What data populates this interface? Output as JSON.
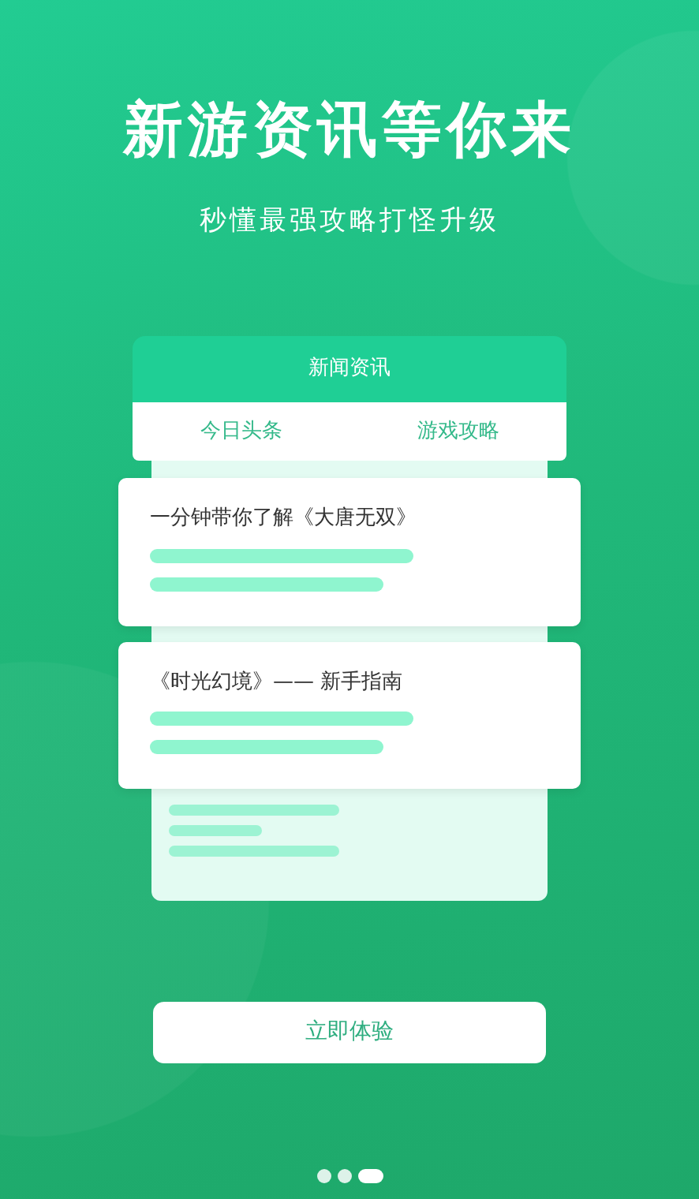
{
  "headline": "新游资讯等你来",
  "subtitle": "秒懂最强攻略打怪升级",
  "mockup": {
    "header": "新闻资讯",
    "tabs": [
      {
        "label": "今日头条",
        "selected": false
      },
      {
        "label": "游戏攻略",
        "selected": false
      }
    ],
    "articles": [
      {
        "title": "一分钟带你了解《大唐无双》"
      },
      {
        "title": "《时光幻境》—— 新手指南"
      }
    ]
  },
  "button": "立即体验",
  "pages": [
    {
      "selected": false
    },
    {
      "selected": false
    },
    {
      "selected": true
    }
  ]
}
